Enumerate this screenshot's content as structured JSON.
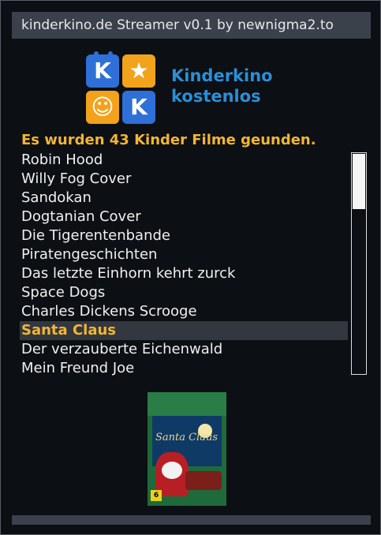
{
  "window": {
    "title": "kinderkino.de Streamer v0.1 by newnigma2.to"
  },
  "logo": {
    "tiles": [
      "K",
      "★",
      "☺",
      "K"
    ],
    "line1": "Kinderkino",
    "line2": "kostenlos"
  },
  "status": {
    "text": "Es wurden 43 Kinder Filme geunden."
  },
  "movies": [
    "Robin Hood",
    "Willy Fog Cover",
    "Sandokan",
    "Dogtanian Cover",
    "Die Tigerentenbande",
    "Piratengeschichten",
    "Das letzte Einhorn kehrt zurck",
    "Space Dogs",
    "Charles Dickens Scrooge",
    "Santa Claus",
    "Der verzauberte Eichenwald",
    "Mein Freund Joe"
  ],
  "selected_index": 9,
  "scrollbar": {
    "position": 0.0
  },
  "cover": {
    "title": "Santa Claus",
    "fsk": "6"
  },
  "colors": {
    "accent": "#f2b632",
    "title_bar": "#3b414a",
    "logo_blue": "#2a8fd6",
    "background": "#0c0f14"
  }
}
